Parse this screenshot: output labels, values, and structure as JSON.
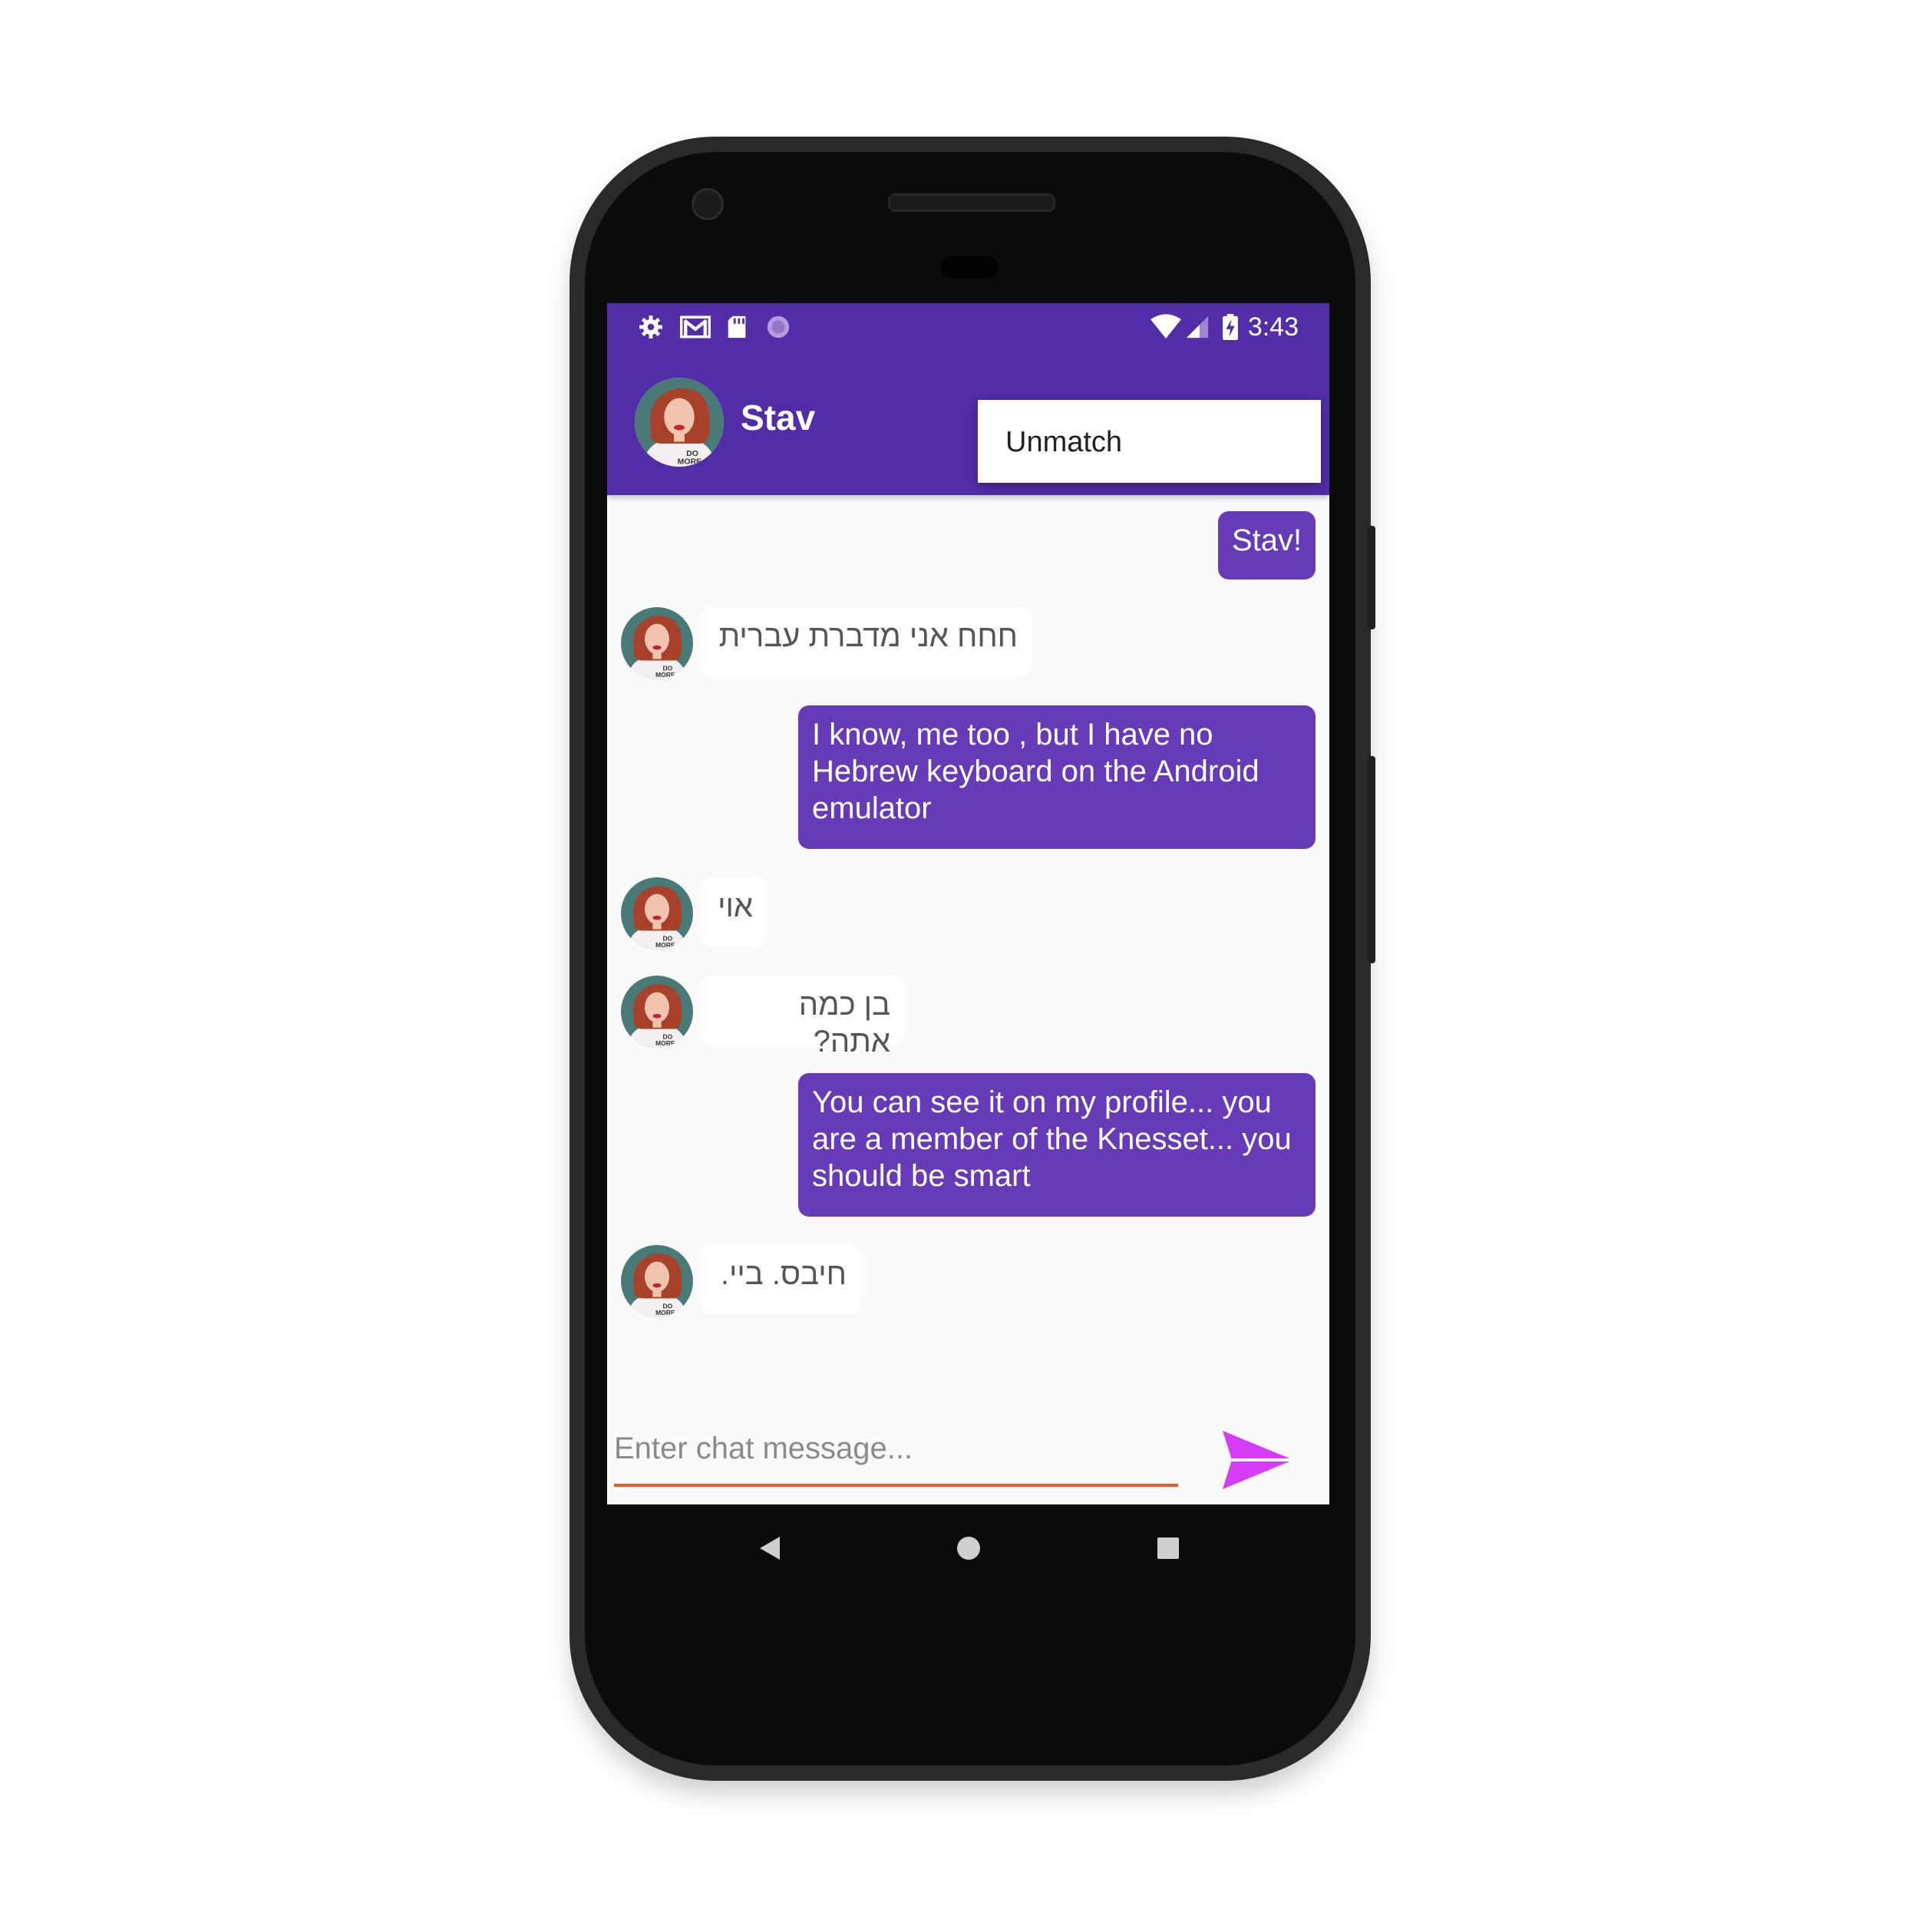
{
  "status_bar": {
    "time": "3:43",
    "left_icons": [
      "gear-icon",
      "gmail-icon",
      "sd-card-icon",
      "sync-icon"
    ],
    "right_icons": [
      "wifi-icon",
      "signal-icon",
      "battery-charging-icon"
    ]
  },
  "toolbar": {
    "contact_name": "Stav",
    "background_color": "#512da8"
  },
  "overflow_menu": {
    "items": [
      {
        "label": "Unmatch"
      }
    ]
  },
  "messages": [
    {
      "side": "sent",
      "text": "Stav!"
    },
    {
      "side": "received",
      "text": "חחח אני מדברת עברית"
    },
    {
      "side": "sent",
      "text": "I know, me too , but I have no Hebrew keyboard on the Android emulator"
    },
    {
      "side": "received",
      "text": "אוי"
    },
    {
      "side": "received",
      "text": "בן כמה אתה?"
    },
    {
      "side": "sent",
      "text": "You can see it on my profile... you are a member of the Knesset... you should be smart"
    },
    {
      "side": "received",
      "text": "חיבס. ביי."
    }
  ],
  "composer": {
    "placeholder": "Enter chat message...",
    "underline_color": "#ec5b24",
    "send_icon": "send-icon",
    "send_color": "#d53cf5"
  },
  "colors": {
    "sent_bubble": "#673ab7",
    "received_bubble": "#ffffff"
  },
  "nav_bar": {
    "buttons": [
      "back-icon",
      "home-icon",
      "recents-icon"
    ]
  }
}
